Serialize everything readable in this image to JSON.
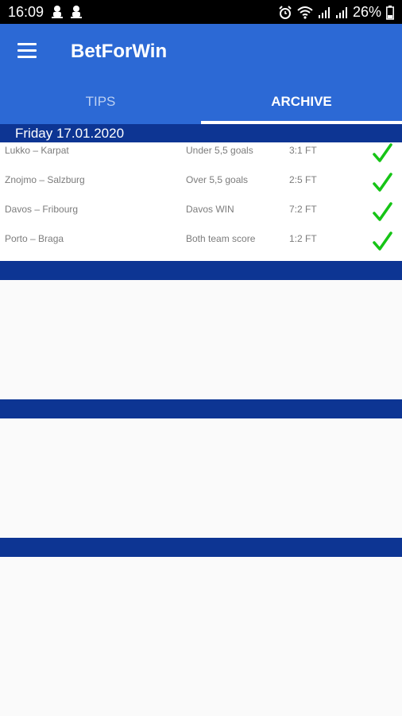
{
  "status_bar": {
    "time": "16:09",
    "battery": "26%",
    "icons": [
      "usb-debug-icon",
      "usb-debug-icon",
      "alarm-icon",
      "wifi-icon",
      "signal-icon",
      "signal-icon",
      "battery-icon"
    ]
  },
  "toolbar": {
    "title": "BetForWin",
    "menu_icon": "hamburger-icon",
    "color": "#2c69d5"
  },
  "tabs": [
    {
      "label": "TIPS",
      "selected": false
    },
    {
      "label": "ARCHIVE",
      "selected": true
    }
  ],
  "archive": {
    "date": "Friday 17.01.2020",
    "header_color": "#0d3593",
    "rows": [
      {
        "match": "Lukko – Karpat",
        "tip": "Under 5,5 goals",
        "result": "3:1 FT",
        "status_icon": "checkmark-icon",
        "status_color": "#16c416"
      },
      {
        "match": "Znojmo – Salzburg",
        "tip": "Over 5,5 goals",
        "result": "2:5 FT",
        "status_icon": "checkmark-icon",
        "status_color": "#16c416"
      },
      {
        "match": "Davos – Fribourg",
        "tip": "Davos WIN",
        "result": "7:2 FT",
        "status_icon": "checkmark-icon",
        "status_color": "#16c416"
      },
      {
        "match": "Porto – Braga",
        "tip": "Both team score",
        "result": "1:2 FT",
        "status_icon": "checkmark-icon",
        "status_color": "#16c416"
      }
    ]
  }
}
